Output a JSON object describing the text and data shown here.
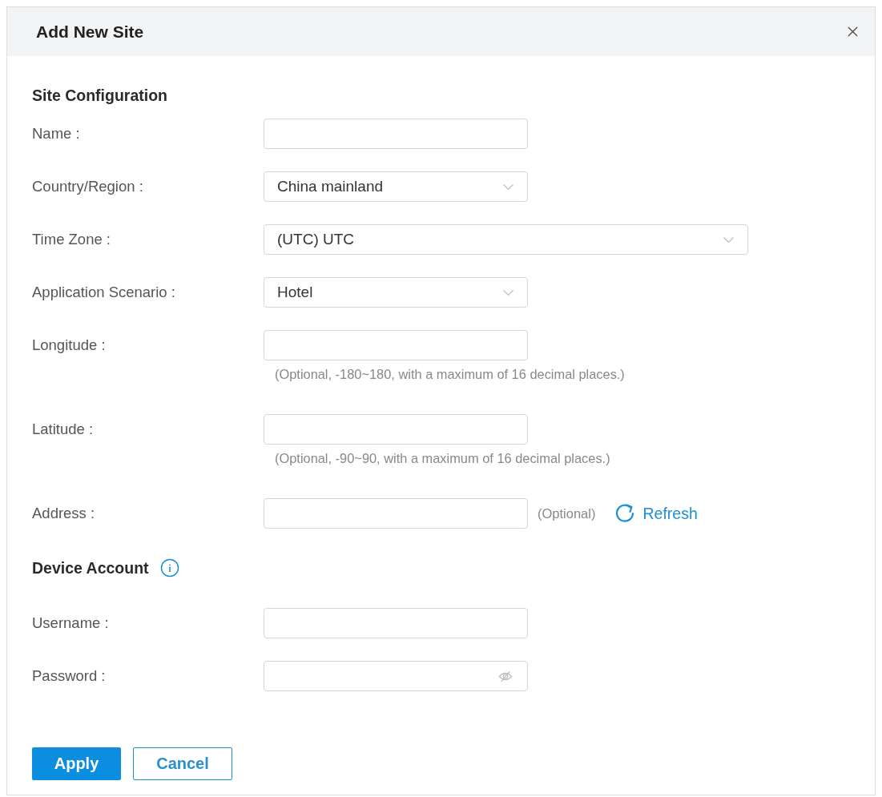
{
  "dialog": {
    "title": "Add New Site"
  },
  "sections": [
    {
      "title": "Site Configuration",
      "info": false,
      "fields": [
        {
          "label": "Name :",
          "kind": "text",
          "wide": false
        },
        {
          "label": "Country/Region :",
          "kind": "select",
          "value": "China mainland",
          "wide": false
        },
        {
          "label": "Time Zone :",
          "kind": "select",
          "value": "(UTC) UTC",
          "wide": true
        },
        {
          "label": "Application Scenario :",
          "kind": "select",
          "value": "Hotel",
          "wide": false
        },
        {
          "label": "Longitude :",
          "kind": "text",
          "wide": false,
          "hint": "(Optional, -180~180, with a maximum of 16 decimal places.)"
        },
        {
          "label": "Latitude :",
          "kind": "text",
          "wide": false,
          "hint": "(Optional, -90~90, with a maximum of 16 decimal places.)"
        },
        {
          "label": "Address :",
          "kind": "text",
          "wide": false,
          "note": "(Optional)",
          "action": "Refresh"
        }
      ]
    },
    {
      "title": "Device Account",
      "info": true,
      "fields": [
        {
          "label": "Username :",
          "kind": "text",
          "wide": false
        },
        {
          "label": "Password :",
          "kind": "password",
          "wide": false
        }
      ]
    }
  ],
  "buttons": [
    {
      "label": "Apply",
      "kind": "primary"
    },
    {
      "label": "Cancel",
      "kind": "secondary"
    }
  ]
}
